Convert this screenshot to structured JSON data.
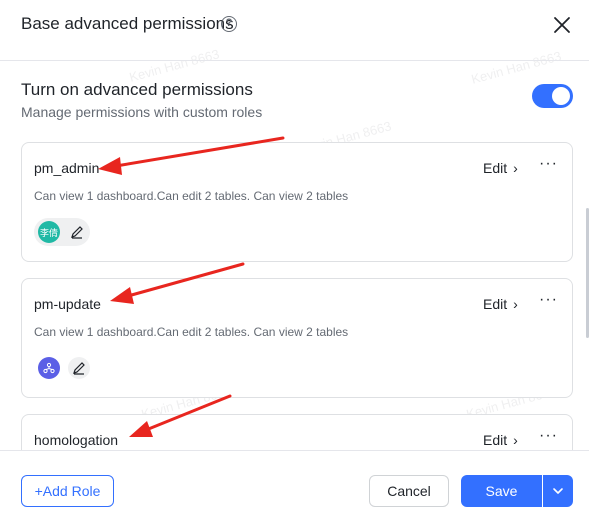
{
  "header": {
    "title": "Base advanced permissions",
    "help_glyph": "?"
  },
  "advanced": {
    "title": "Turn on advanced permissions",
    "subtitle": "Manage permissions with custom roles",
    "enabled": true,
    "accent": "#3370ff"
  },
  "roles": [
    {
      "name": "pm_admin",
      "edit_label": "Edit",
      "description": "Can view 1 dashboard.Can edit 2 tables. Can view 2 tables",
      "avatar": {
        "label": "李倩",
        "color": "#20b9a5",
        "icon": "user-avatar"
      }
    },
    {
      "name": "pm-update",
      "edit_label": "Edit",
      "description": "Can view 1 dashboard.Can edit 2 tables. Can view 2 tables",
      "avatar": {
        "label": "",
        "color": "#5b5fe6",
        "icon": "org-chart-icon"
      }
    },
    {
      "name": "homologation",
      "edit_label": "Edit"
    }
  ],
  "footer": {
    "add_role_label": "+Add Role",
    "cancel_label": "Cancel",
    "save_label": "Save"
  },
  "watermark_text": "Kevin Han 8663",
  "annotation_color": "#e8261f"
}
